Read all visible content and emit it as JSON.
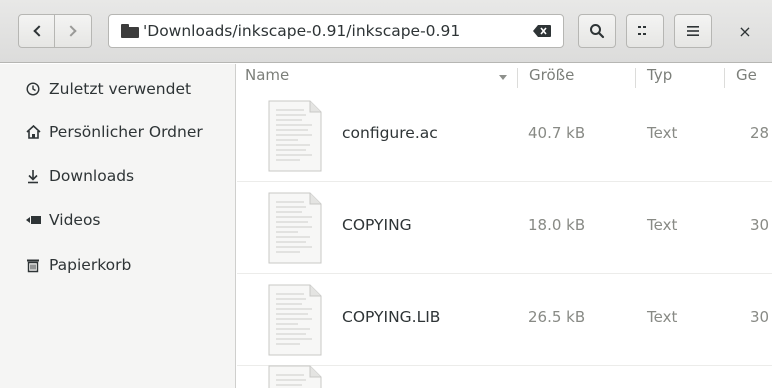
{
  "header": {
    "path": "'Downloads/inkscape-0.91/inkscape-0.91",
    "back_icon": "chevron-left-icon",
    "forward_icon": "chevron-right-icon",
    "search_icon": "search-icon",
    "view_icon": "view-toggle-icon",
    "menu_icon": "hamburger-menu-icon",
    "close_label": "×"
  },
  "sidebar": {
    "items": [
      {
        "label": "Zuletzt verwendet",
        "icon": "clock-icon"
      },
      {
        "label": "Persönlicher Ordner",
        "icon": "home-icon"
      },
      {
        "label": "Downloads",
        "icon": "download-icon"
      },
      {
        "label": "Videos",
        "icon": "video-icon"
      },
      {
        "label": "Papierkorb",
        "icon": "trash-icon"
      }
    ]
  },
  "columns": {
    "name": "Name",
    "size": "Größe",
    "type": "Typ",
    "modified": "Ge"
  },
  "files": [
    {
      "name": "configure.ac",
      "size": "40.7 kB",
      "type": "Text",
      "modified": "28"
    },
    {
      "name": "COPYING",
      "size": "18.0 kB",
      "type": "Text",
      "modified": "30"
    },
    {
      "name": "COPYING.LIB",
      "size": "26.5 kB",
      "type": "Text",
      "modified": "30"
    }
  ],
  "colors": {
    "header_bg": "#dcdcdb",
    "sidebar_bg": "#f5f5f4",
    "text": "#2e3436",
    "muted": "#888a85"
  }
}
